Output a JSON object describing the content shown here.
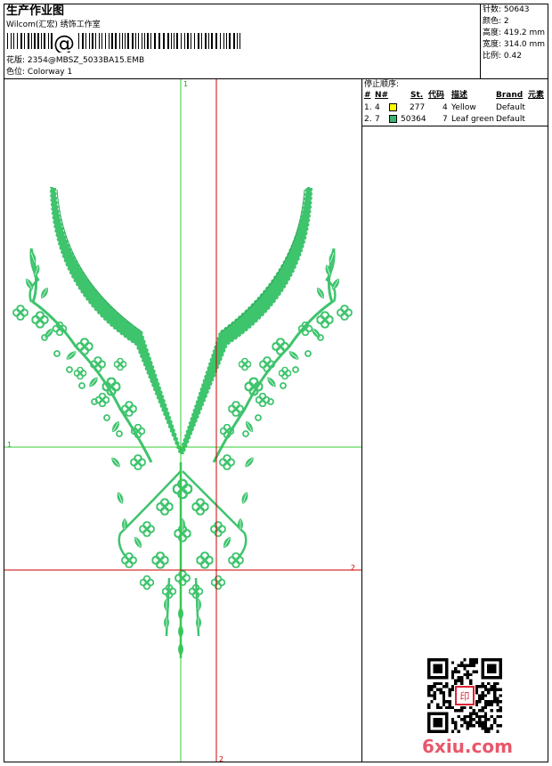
{
  "header": {
    "title": "生产作业图",
    "company": "Wilcom(汇宏) 绣饰工作室",
    "design_label": "花版:",
    "design_value": "2354@MBSZ_5033BA15.EMB",
    "colorway_label": "色位:",
    "colorway_value": "Colorway 1"
  },
  "info": {
    "stitches": "针数: 50643",
    "colors": "颜色: 2",
    "height": "高度: 419.2 mm",
    "width": "宽度: 314.0 mm",
    "scale": "比例: 0.42"
  },
  "stop_sequence": {
    "title": "停止顺序:",
    "headers": [
      "#",
      "N#",
      "St.",
      "代码",
      "描述",
      "Brand",
      "元素"
    ],
    "rows": [
      {
        "num": "1.",
        "needle": "4",
        "color": "#ffff00",
        "stitches": "277",
        "code": "4",
        "desc": "Yellow",
        "brand": "Default"
      },
      {
        "num": "2.",
        "needle": "7",
        "color": "#3cb371",
        "stitches": "50364",
        "code": "7",
        "desc": "Leaf green",
        "brand": "Default"
      }
    ]
  },
  "guides": {
    "green_vertical": "1",
    "green_horizontal": "1",
    "red_vertical": "2",
    "red_horizontal": "2"
  },
  "watermark": "6xiu.com",
  "colors": {
    "embroidery": "#3ec46d",
    "guide_green": "#33cc33",
    "guide_red": "#cc0000"
  }
}
